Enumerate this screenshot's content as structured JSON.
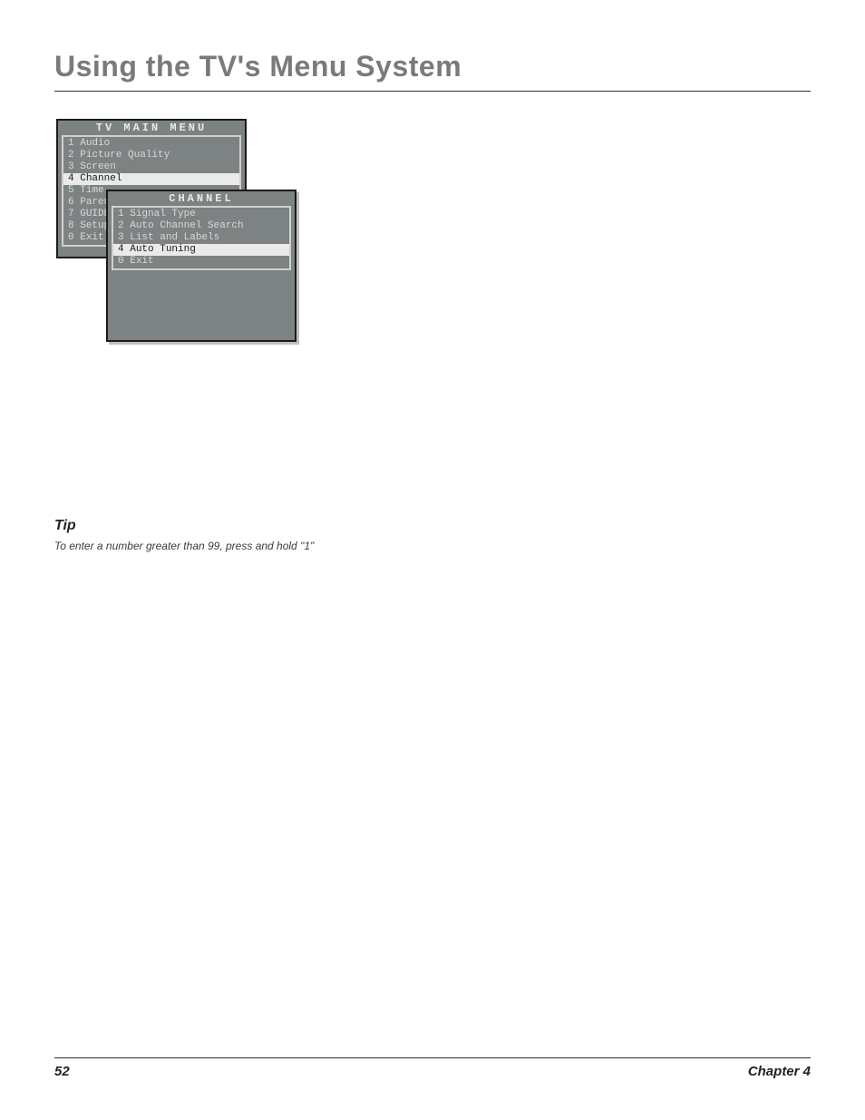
{
  "header": {
    "title": "Using the TV's Menu System"
  },
  "tv_main_menu": {
    "title": "TV MAIN MENU",
    "items": {
      "i0": {
        "num": "1",
        "label": "Audio"
      },
      "i1": {
        "num": "2",
        "label": "Picture Quality"
      },
      "i2": {
        "num": "3",
        "label": "Screen"
      },
      "i3": {
        "num": "4",
        "label": "Channel"
      },
      "i4": {
        "num": "5",
        "label": "Time"
      },
      "i5": {
        "num": "6",
        "label": "Parental Controls"
      },
      "i6": {
        "num": "7",
        "label": "GUIDE Plus+ Menu"
      },
      "i7": {
        "num": "8",
        "label": "Setup"
      },
      "i8": {
        "num": "0",
        "label": "Exit"
      }
    }
  },
  "channel_menu": {
    "title": "CHANNEL",
    "items": {
      "c0": {
        "num": "1",
        "label": "Signal Type"
      },
      "c1": {
        "num": "2",
        "label": "Auto Channel Search"
      },
      "c2": {
        "num": "3",
        "label": "List and Labels"
      },
      "c3": {
        "num": "4",
        "label": "Auto Tuning"
      },
      "c4": {
        "num": "0",
        "label": "Exit"
      }
    }
  },
  "tip": {
    "heading": "Tip",
    "text": "To enter a number greater than 99, press and hold \"1\""
  },
  "footer": {
    "page": "52",
    "chapter": "Chapter 4"
  }
}
